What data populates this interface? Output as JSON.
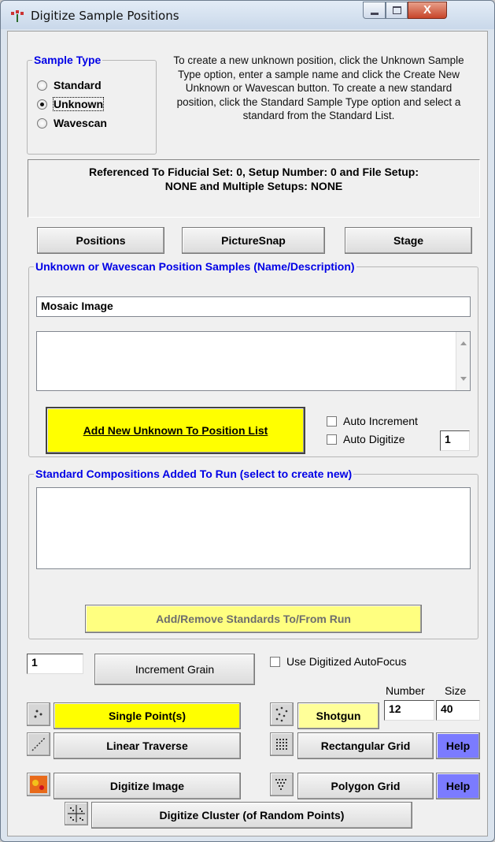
{
  "window": {
    "title": "Digitize Sample Positions",
    "close_glyph": "X"
  },
  "sample_type": {
    "legend": "Sample Type",
    "options": [
      "Standard",
      "Unknown",
      "Wavescan"
    ],
    "selected": "Unknown",
    "info": "To create a new unknown position, click the Unknown Sample Type option, enter a sample name and click the Create New Unknown or Wavescan button. To create a new standard position, click the Standard Sample Type option and select a standard from the Standard List."
  },
  "reference": {
    "line1": "Referenced To Fiducial Set: 0, Setup Number:  0 and File Setup:",
    "line2": "NONE and Multiple Setups: NONE"
  },
  "nav_buttons": {
    "positions": "Positions",
    "picturesnap": "PictureSnap",
    "stage": "Stage"
  },
  "unknown_group": {
    "legend": "Unknown or Wavescan Position Samples (Name/Description)",
    "name_value": "Mosaic Image",
    "description_value": "",
    "add_button": "Add New Unknown To Position List",
    "auto_increment": "Auto Increment",
    "auto_digitize": "Auto Digitize",
    "auto_digitize_value": "1"
  },
  "standards_group": {
    "legend": "Standard Compositions Added To Run (select to create new)",
    "add_remove_button": "Add/Remove Standards To/From Run"
  },
  "grain": {
    "value": "1",
    "increment_button": "Increment Grain"
  },
  "autofocus_label": "Use Digitized AutoFocus",
  "shotgun": {
    "number_label": "Number",
    "size_label": "Size",
    "number_value": "12",
    "size_value": "40"
  },
  "digitize_buttons": {
    "single_point": "Single Point(s)",
    "linear_traverse": "Linear Traverse",
    "digitize_image": "Digitize Image",
    "shotgun": "Shotgun",
    "rectangular_grid": "Rectangular Grid",
    "polygon_grid": "Polygon Grid",
    "help": "Help",
    "digitize_cluster": "Digitize Cluster (of Random Points)"
  },
  "icons": [
    "app-icon",
    "minimize-icon",
    "maximize-icon",
    "close-icon",
    "single-point-icon",
    "linear-traverse-icon",
    "digitize-image-icon",
    "shotgun-icon",
    "rectangular-grid-icon",
    "polygon-grid-icon",
    "cluster-icon"
  ]
}
